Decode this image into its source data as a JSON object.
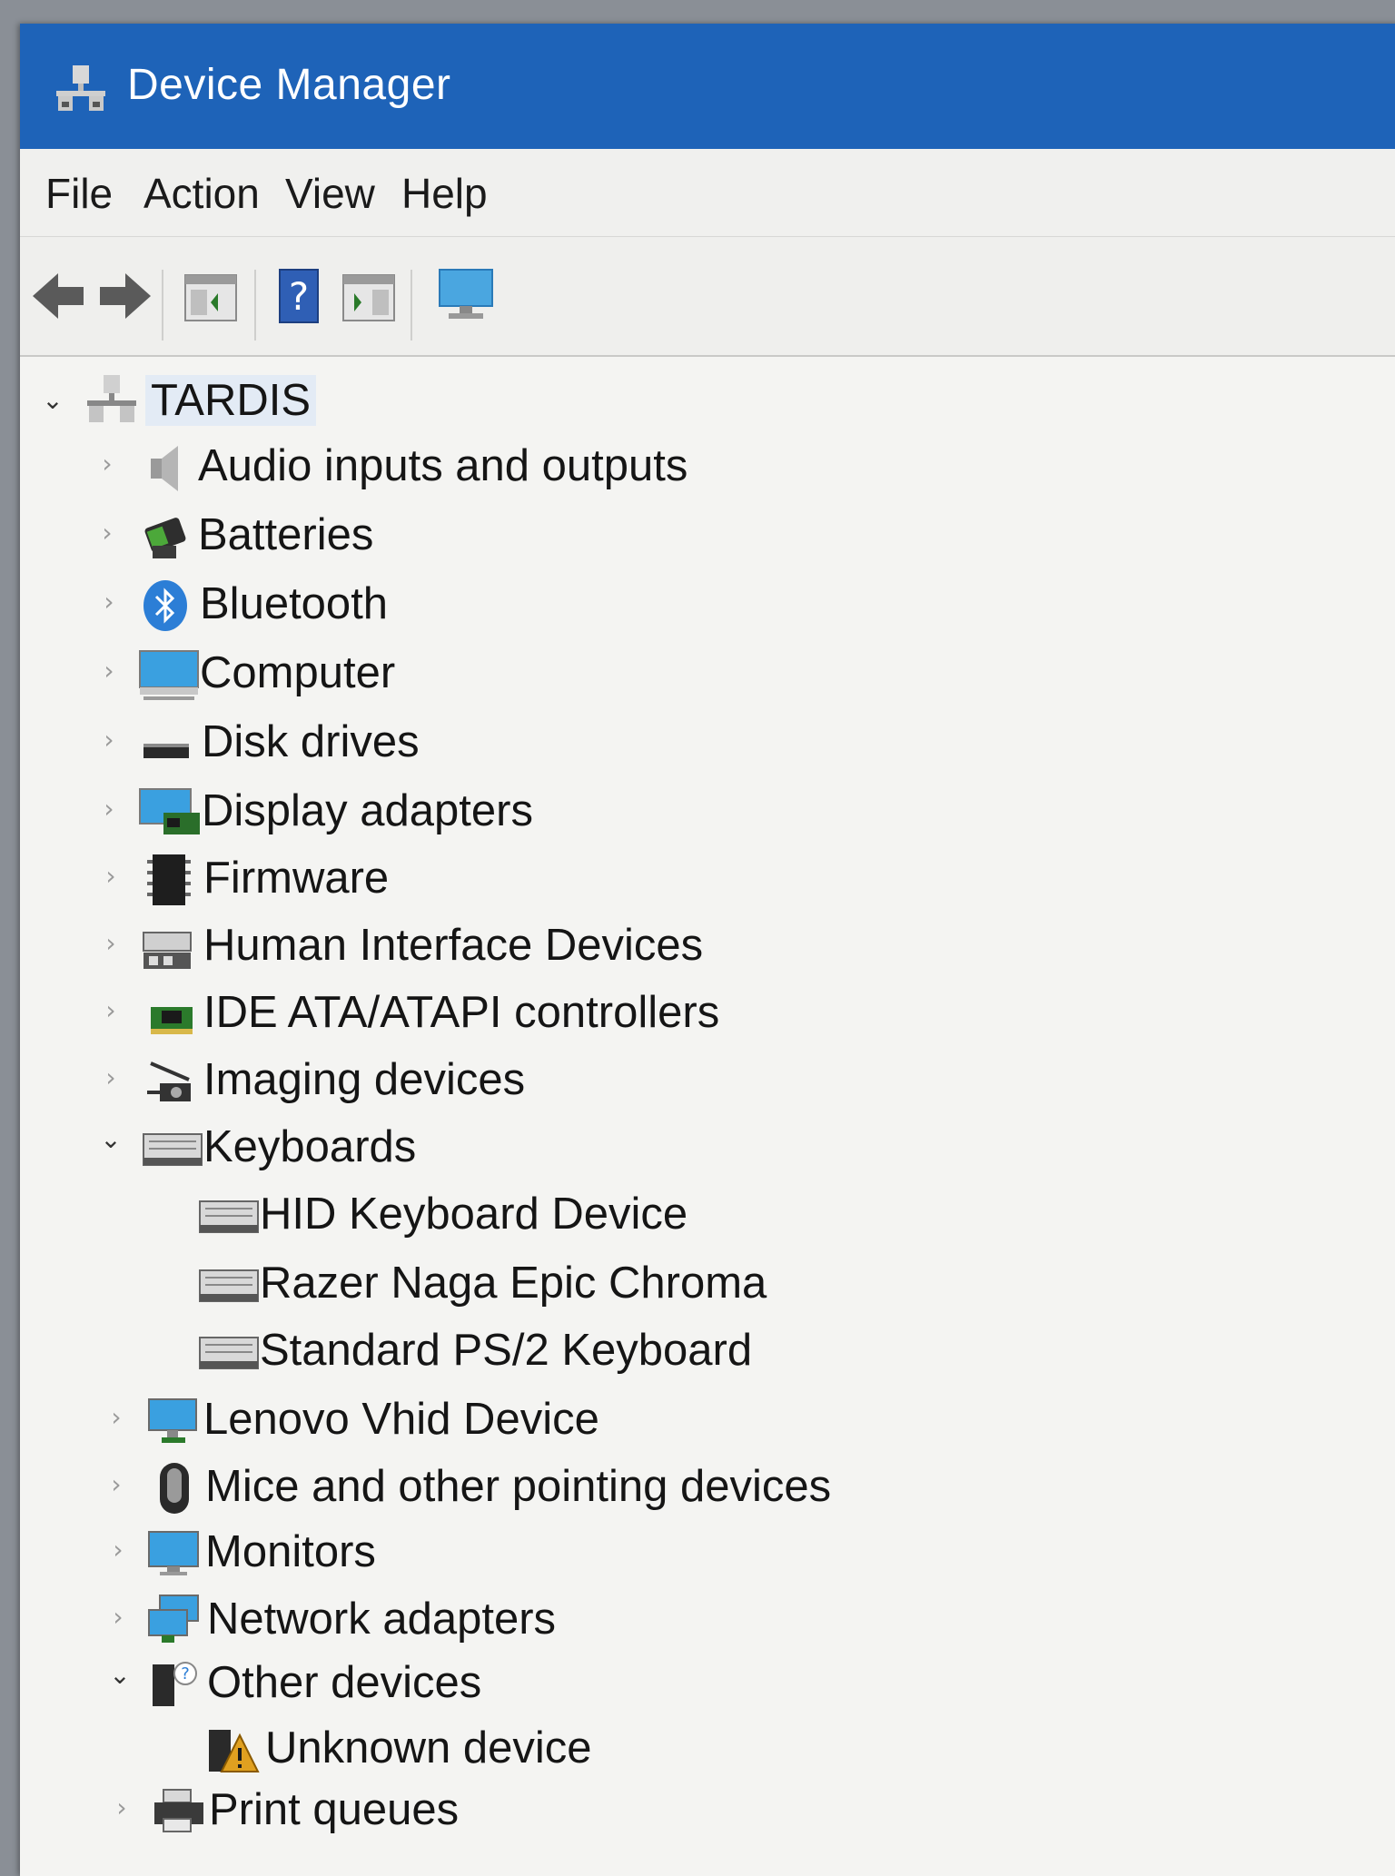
{
  "window": {
    "title": "Device Manager"
  },
  "menu": {
    "file": "File",
    "action": "Action",
    "view": "View",
    "help": "Help"
  },
  "toolbar": {
    "buttons": [
      "back-arrow-icon",
      "forward-arrow-icon",
      "show-hide-console-tree-icon",
      "help-icon",
      "action-pane-icon",
      "monitor-icon"
    ]
  },
  "tree": {
    "root": "TARDIS",
    "items": [
      {
        "label": "Audio inputs and outputs",
        "icon": "speaker-icon",
        "expanded": false
      },
      {
        "label": "Batteries",
        "icon": "battery-icon",
        "expanded": false
      },
      {
        "label": "Bluetooth",
        "icon": "bluetooth-icon",
        "expanded": false
      },
      {
        "label": "Computer",
        "icon": "computer-icon",
        "expanded": false
      },
      {
        "label": "Disk drives",
        "icon": "disk-drive-icon",
        "expanded": false
      },
      {
        "label": "Display adapters",
        "icon": "display-adapter-icon",
        "expanded": false
      },
      {
        "label": "Firmware",
        "icon": "firmware-chip-icon",
        "expanded": false
      },
      {
        "label": "Human Interface Devices",
        "icon": "hid-icon",
        "expanded": false
      },
      {
        "label": "IDE ATA/ATAPI controllers",
        "icon": "ide-controller-icon",
        "expanded": false
      },
      {
        "label": "Imaging devices",
        "icon": "camera-icon",
        "expanded": false
      },
      {
        "label": "Keyboards",
        "icon": "keyboard-icon",
        "expanded": true,
        "children": [
          "HID Keyboard Device",
          "Razer Naga Epic Chroma",
          "Standard PS/2 Keyboard"
        ]
      },
      {
        "label": "Lenovo Vhid Device",
        "icon": "network-monitor-icon",
        "expanded": false
      },
      {
        "label": "Mice and other pointing devices",
        "icon": "mouse-icon",
        "expanded": false
      },
      {
        "label": "Monitors",
        "icon": "monitor-icon",
        "expanded": false
      },
      {
        "label": "Network adapters",
        "icon": "network-adapter-icon",
        "expanded": false
      },
      {
        "label": "Other devices",
        "icon": "unknown-device-icon",
        "expanded": true,
        "children": [
          "Unknown device"
        ]
      },
      {
        "label": "Print queues",
        "icon": "printer-icon",
        "expanded": false
      }
    ]
  },
  "colors": {
    "titlebar": "#1e63b8",
    "background": "#f4f4f2",
    "text": "#151515"
  }
}
